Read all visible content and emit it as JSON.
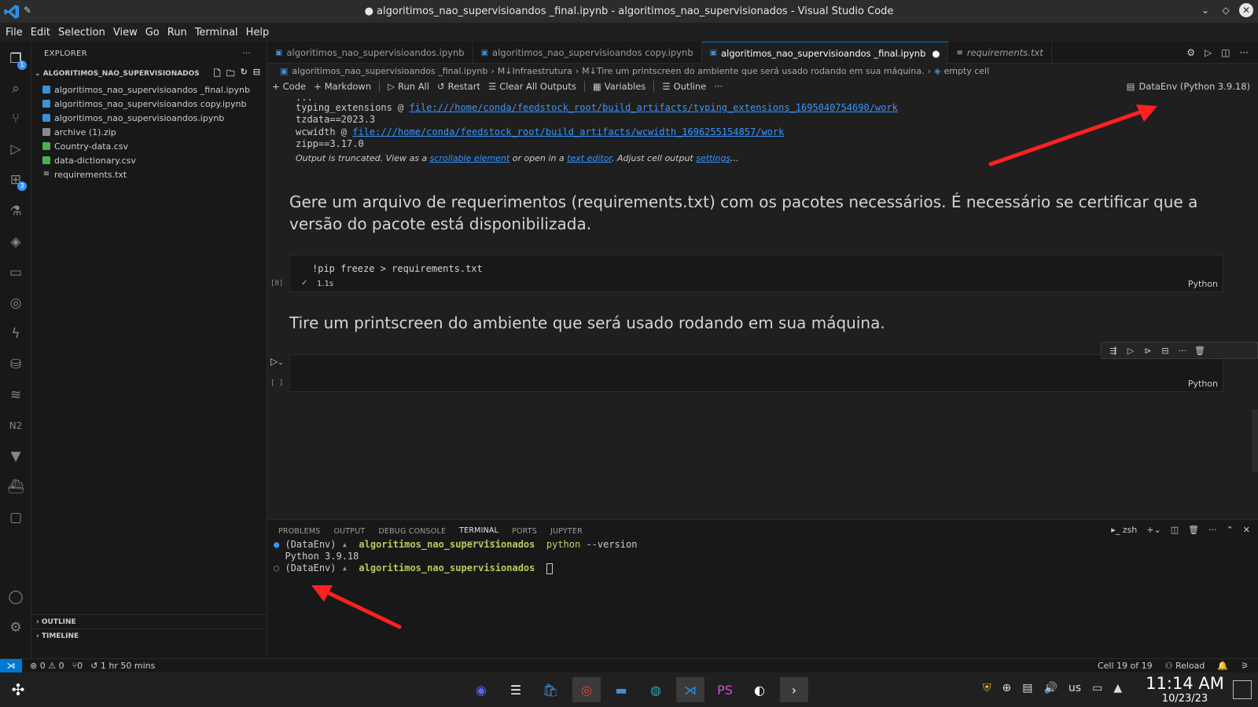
{
  "window": {
    "title": "● algoritimos_nao_supervisioandos _final.ipynb - algoritimos_nao_supervisionados - Visual Studio Code"
  },
  "menu": [
    "File",
    "Edit",
    "Selection",
    "View",
    "Go",
    "Run",
    "Terminal",
    "Help"
  ],
  "activity": {
    "extensions_badge": "3",
    "explorer_badge": "1"
  },
  "sidebar": {
    "header": "EXPLORER",
    "folder": "ALGORITIMOS_NAO_SUPERVISIONADOS",
    "files": [
      {
        "name": "algoritimos_nao_supervisioandos _final.ipynb",
        "type": "nb"
      },
      {
        "name": "algoritimos_nao_supervisioandos copy.ipynb",
        "type": "nb"
      },
      {
        "name": "algoritimos_nao_supervisioandos.ipynb",
        "type": "nb"
      },
      {
        "name": "archive (1).zip",
        "type": "zip"
      },
      {
        "name": "Country-data.csv",
        "type": "csv"
      },
      {
        "name": "data-dictionary.csv",
        "type": "csv"
      },
      {
        "name": "requirements.txt",
        "type": "txt"
      }
    ],
    "outline": "OUTLINE",
    "timeline": "TIMELINE"
  },
  "tabs": [
    {
      "label": "algoritimos_nao_supervisioandos.ipynb"
    },
    {
      "label": "algoritimos_nao_supervisioandos copy.ipynb"
    },
    {
      "label": "algoritimos_nao_supervisioandos _final.ipynb"
    },
    {
      "label": "requirements.txt"
    }
  ],
  "breadcrumb": [
    "algoritimos_nao_supervisioandos _final.ipynb",
    "M↓Infraestrutura",
    "M↓Tire um printscreen do ambiente que será usado rodando em sua máquina.",
    "empty cell"
  ],
  "toolbar": {
    "code": "Code",
    "markdown": "Markdown",
    "run_all": "Run All",
    "restart": "Restart",
    "clear": "Clear All Outputs",
    "variables": "Variables",
    "outline": "Outline",
    "more": "···",
    "kernel": "DataEnv (Python 3.9.18)"
  },
  "output": {
    "dots": "...",
    "l1_prefix": "typing_extensions @ ",
    "l1_link": "file:///home/conda/feedstock_root/build_artifacts/typing_extensions_1695040754690/work",
    "l2": "tzdata==2023.3",
    "l3_prefix": "wcwidth @ ",
    "l3_link": "file:///home/conda/feedstock_root/build_artifacts/wcwidth_1696255154857/work",
    "l4": "zipp==3.17.0",
    "trunc_a": "Output is truncated. View as a ",
    "trunc_link1": "scrollable element",
    "trunc_b": " or open in a ",
    "trunc_link2": "text editor",
    "trunc_c": ". Adjust cell output ",
    "trunc_link3": "settings",
    "trunc_d": "..."
  },
  "md1": "Gere um arquivo de requerimentos (requirements.txt) com os pacotes necessários. É necessário se certificar que a versão do pacote está disponibilizada.",
  "cell8": {
    "exec": "[8]",
    "code": "!pip freeze > requirements.txt",
    "status": "1.1s",
    "lang": "Python"
  },
  "md2": "Tire um printscreen do ambiente que será usado rodando em sua máquina.",
  "cell_empty": {
    "exec": "[ ]",
    "lang": "Python"
  },
  "panel": {
    "tabs": [
      "PROBLEMS",
      "OUTPUT",
      "DEBUG CONSOLE",
      "TERMINAL",
      "PORTS",
      "JUPYTER"
    ],
    "shell": "zsh",
    "line1_env": "(DataEnv)",
    "line1_dir": "algoritimos_nao_supervisionados",
    "line1_cmd": "python",
    "line1_arg": "--version",
    "line2": "Python 3.9.18",
    "line3_env": "(DataEnv)",
    "line3_dir": "algoritimos_nao_supervisionados"
  },
  "status": {
    "errors": "⊗ 0 ⚠ 0",
    "ports": "⑂0",
    "time": "1 hr 50 mins",
    "cell": "Cell 19 of 19",
    "reload": "Reload"
  },
  "clock": {
    "time": "11:14 AM",
    "date": "10/23/23"
  },
  "tray": {
    "lang": "us"
  },
  "colors": {
    "accent": "#0078d4",
    "arrow": "#ff2020",
    "link": "#3794ff"
  }
}
